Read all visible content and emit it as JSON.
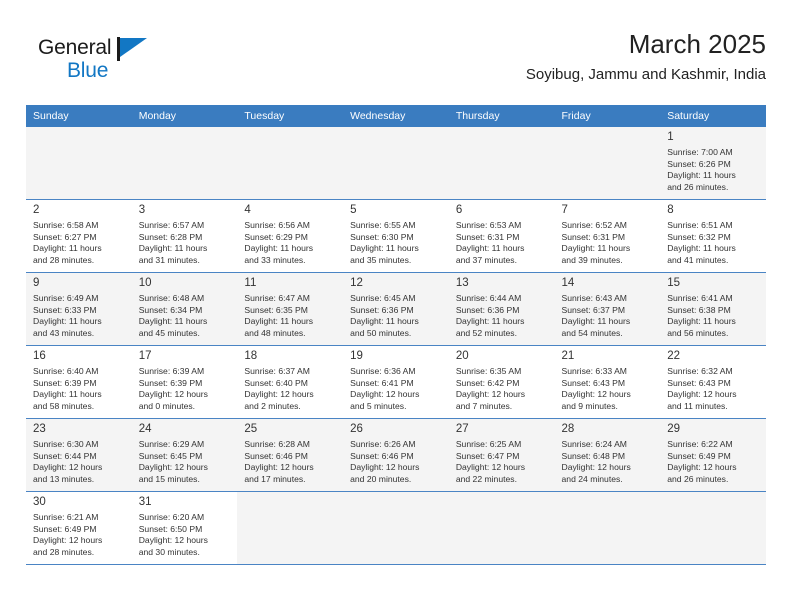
{
  "brand": {
    "name_top": "General",
    "name_bottom": "Blue",
    "flag_icon": "blue-triangle-flag-icon",
    "accent_color": "#1277c4"
  },
  "header": {
    "title": "March 2025",
    "subtitle": "Soyibug, Jammu and Kashmir, India"
  },
  "theme": {
    "header_row_bg": "#3a7cc0",
    "row_alt_bg": "#f4f4f4",
    "cell_border": "#4a84c4"
  },
  "calendar": {
    "weekday_headers": [
      "Sunday",
      "Monday",
      "Tuesday",
      "Wednesday",
      "Thursday",
      "Friday",
      "Saturday"
    ],
    "weeks": [
      [
        {
          "day": "",
          "lines": []
        },
        {
          "day": "",
          "lines": []
        },
        {
          "day": "",
          "lines": []
        },
        {
          "day": "",
          "lines": []
        },
        {
          "day": "",
          "lines": []
        },
        {
          "day": "",
          "lines": []
        },
        {
          "day": "1",
          "lines": [
            "Sunrise: 7:00 AM",
            "Sunset: 6:26 PM",
            "Daylight: 11 hours",
            "and 26 minutes."
          ]
        }
      ],
      [
        {
          "day": "2",
          "lines": [
            "Sunrise: 6:58 AM",
            "Sunset: 6:27 PM",
            "Daylight: 11 hours",
            "and 28 minutes."
          ]
        },
        {
          "day": "3",
          "lines": [
            "Sunrise: 6:57 AM",
            "Sunset: 6:28 PM",
            "Daylight: 11 hours",
            "and 31 minutes."
          ]
        },
        {
          "day": "4",
          "lines": [
            "Sunrise: 6:56 AM",
            "Sunset: 6:29 PM",
            "Daylight: 11 hours",
            "and 33 minutes."
          ]
        },
        {
          "day": "5",
          "lines": [
            "Sunrise: 6:55 AM",
            "Sunset: 6:30 PM",
            "Daylight: 11 hours",
            "and 35 minutes."
          ]
        },
        {
          "day": "6",
          "lines": [
            "Sunrise: 6:53 AM",
            "Sunset: 6:31 PM",
            "Daylight: 11 hours",
            "and 37 minutes."
          ]
        },
        {
          "day": "7",
          "lines": [
            "Sunrise: 6:52 AM",
            "Sunset: 6:31 PM",
            "Daylight: 11 hours",
            "and 39 minutes."
          ]
        },
        {
          "day": "8",
          "lines": [
            "Sunrise: 6:51 AM",
            "Sunset: 6:32 PM",
            "Daylight: 11 hours",
            "and 41 minutes."
          ]
        }
      ],
      [
        {
          "day": "9",
          "lines": [
            "Sunrise: 6:49 AM",
            "Sunset: 6:33 PM",
            "Daylight: 11 hours",
            "and 43 minutes."
          ]
        },
        {
          "day": "10",
          "lines": [
            "Sunrise: 6:48 AM",
            "Sunset: 6:34 PM",
            "Daylight: 11 hours",
            "and 45 minutes."
          ]
        },
        {
          "day": "11",
          "lines": [
            "Sunrise: 6:47 AM",
            "Sunset: 6:35 PM",
            "Daylight: 11 hours",
            "and 48 minutes."
          ]
        },
        {
          "day": "12",
          "lines": [
            "Sunrise: 6:45 AM",
            "Sunset: 6:36 PM",
            "Daylight: 11 hours",
            "and 50 minutes."
          ]
        },
        {
          "day": "13",
          "lines": [
            "Sunrise: 6:44 AM",
            "Sunset: 6:36 PM",
            "Daylight: 11 hours",
            "and 52 minutes."
          ]
        },
        {
          "day": "14",
          "lines": [
            "Sunrise: 6:43 AM",
            "Sunset: 6:37 PM",
            "Daylight: 11 hours",
            "and 54 minutes."
          ]
        },
        {
          "day": "15",
          "lines": [
            "Sunrise: 6:41 AM",
            "Sunset: 6:38 PM",
            "Daylight: 11 hours",
            "and 56 minutes."
          ]
        }
      ],
      [
        {
          "day": "16",
          "lines": [
            "Sunrise: 6:40 AM",
            "Sunset: 6:39 PM",
            "Daylight: 11 hours",
            "and 58 minutes."
          ]
        },
        {
          "day": "17",
          "lines": [
            "Sunrise: 6:39 AM",
            "Sunset: 6:39 PM",
            "Daylight: 12 hours",
            "and 0 minutes."
          ]
        },
        {
          "day": "18",
          "lines": [
            "Sunrise: 6:37 AM",
            "Sunset: 6:40 PM",
            "Daylight: 12 hours",
            "and 2 minutes."
          ]
        },
        {
          "day": "19",
          "lines": [
            "Sunrise: 6:36 AM",
            "Sunset: 6:41 PM",
            "Daylight: 12 hours",
            "and 5 minutes."
          ]
        },
        {
          "day": "20",
          "lines": [
            "Sunrise: 6:35 AM",
            "Sunset: 6:42 PM",
            "Daylight: 12 hours",
            "and 7 minutes."
          ]
        },
        {
          "day": "21",
          "lines": [
            "Sunrise: 6:33 AM",
            "Sunset: 6:43 PM",
            "Daylight: 12 hours",
            "and 9 minutes."
          ]
        },
        {
          "day": "22",
          "lines": [
            "Sunrise: 6:32 AM",
            "Sunset: 6:43 PM",
            "Daylight: 12 hours",
            "and 11 minutes."
          ]
        }
      ],
      [
        {
          "day": "23",
          "lines": [
            "Sunrise: 6:30 AM",
            "Sunset: 6:44 PM",
            "Daylight: 12 hours",
            "and 13 minutes."
          ]
        },
        {
          "day": "24",
          "lines": [
            "Sunrise: 6:29 AM",
            "Sunset: 6:45 PM",
            "Daylight: 12 hours",
            "and 15 minutes."
          ]
        },
        {
          "day": "25",
          "lines": [
            "Sunrise: 6:28 AM",
            "Sunset: 6:46 PM",
            "Daylight: 12 hours",
            "and 17 minutes."
          ]
        },
        {
          "day": "26",
          "lines": [
            "Sunrise: 6:26 AM",
            "Sunset: 6:46 PM",
            "Daylight: 12 hours",
            "and 20 minutes."
          ]
        },
        {
          "day": "27",
          "lines": [
            "Sunrise: 6:25 AM",
            "Sunset: 6:47 PM",
            "Daylight: 12 hours",
            "and 22 minutes."
          ]
        },
        {
          "day": "28",
          "lines": [
            "Sunrise: 6:24 AM",
            "Sunset: 6:48 PM",
            "Daylight: 12 hours",
            "and 24 minutes."
          ]
        },
        {
          "day": "29",
          "lines": [
            "Sunrise: 6:22 AM",
            "Sunset: 6:49 PM",
            "Daylight: 12 hours",
            "and 26 minutes."
          ]
        }
      ],
      [
        {
          "day": "30",
          "lines": [
            "Sunrise: 6:21 AM",
            "Sunset: 6:49 PM",
            "Daylight: 12 hours",
            "and 28 minutes."
          ]
        },
        {
          "day": "31",
          "lines": [
            "Sunrise: 6:20 AM",
            "Sunset: 6:50 PM",
            "Daylight: 12 hours",
            "and 30 minutes."
          ]
        },
        {
          "day": "",
          "lines": []
        },
        {
          "day": "",
          "lines": []
        },
        {
          "day": "",
          "lines": []
        },
        {
          "day": "",
          "lines": []
        },
        {
          "day": "",
          "lines": []
        }
      ]
    ]
  }
}
